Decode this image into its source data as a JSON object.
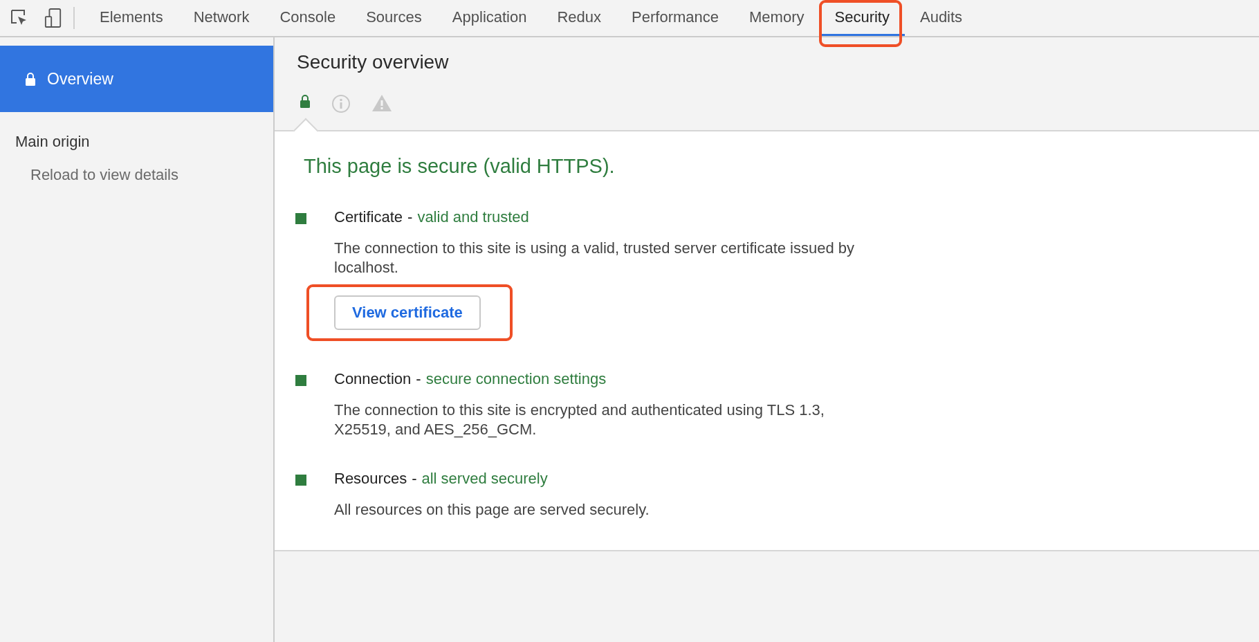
{
  "toolbar": {
    "tabs": [
      {
        "label": "Elements",
        "selected": false,
        "highlighted": false
      },
      {
        "label": "Network",
        "selected": false,
        "highlighted": false
      },
      {
        "label": "Console",
        "selected": false,
        "highlighted": false
      },
      {
        "label": "Sources",
        "selected": false,
        "highlighted": false
      },
      {
        "label": "Application",
        "selected": false,
        "highlighted": false
      },
      {
        "label": "Redux",
        "selected": false,
        "highlighted": false
      },
      {
        "label": "Performance",
        "selected": false,
        "highlighted": false
      },
      {
        "label": "Memory",
        "selected": false,
        "highlighted": false
      },
      {
        "label": "Security",
        "selected": true,
        "highlighted": true
      },
      {
        "label": "Audits",
        "selected": false,
        "highlighted": false
      }
    ]
  },
  "sidebar": {
    "overview": {
      "label": "Overview",
      "selected": true
    },
    "main_origin": {
      "label": "Main origin",
      "hint": "Reload to view details"
    }
  },
  "main": {
    "title": "Security overview",
    "summary_tabs": [
      {
        "kind": "secure",
        "selected": true
      },
      {
        "kind": "info",
        "selected": false
      },
      {
        "kind": "warning",
        "selected": false
      }
    ],
    "summary": "This page is secure (valid HTTPS).",
    "items": [
      {
        "title": "Certificate",
        "separator": "-",
        "status": "valid and trusted",
        "description": "The connection to this site is using a valid, trusted server certificate issued by localhost.",
        "button": {
          "label": "View certificate",
          "highlighted": true
        }
      },
      {
        "title": "Connection",
        "separator": "-",
        "status": "secure connection settings",
        "description": "The connection to this site is encrypted and authenticated using TLS 1.3, X25519, and AES_256_GCM."
      },
      {
        "title": "Resources",
        "separator": "-",
        "status": "all served securely",
        "description": "All resources on this page are served securely."
      }
    ]
  }
}
